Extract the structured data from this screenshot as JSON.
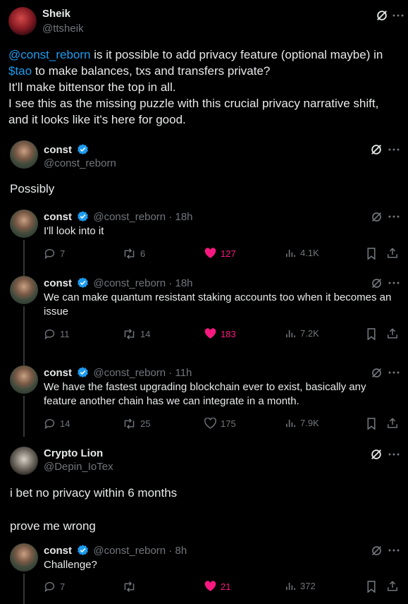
{
  "main_post": {
    "author_name": "Sheik",
    "author_handle": "@ttsheik",
    "mention": "@const_reborn",
    "text_part1": " is it possible to add privacy feature (optional maybe) in",
    "cashtag": "$tao",
    "text_part2": " to make balances, txs and transfers private?",
    "line3": "It'll make bittensor the top in all.",
    "line4": "I see this as the missing puzzle with this crucial privacy narrative shift,",
    "line5": "and it looks like it's here for good."
  },
  "reply1": {
    "author_name": "const",
    "author_handle": "@const_reborn",
    "text": "Possibly"
  },
  "thread": [
    {
      "author_name": "const",
      "meta": "@const_reborn · 18h",
      "text_lines": [
        "I'll look into it"
      ],
      "replies": "7",
      "reposts": "6",
      "likes": "127",
      "views": "4.1K",
      "liked": true
    },
    {
      "author_name": "const",
      "meta": "@const_reborn · 18h",
      "text_lines": [
        "We can make quantum resistant staking accounts too when it becomes an",
        "issue"
      ],
      "replies": "11",
      "reposts": "14",
      "likes": "183",
      "views": "7.2K",
      "liked": true
    },
    {
      "author_name": "const",
      "meta": "@const_reborn · 11h",
      "text_lines": [
        "We have the fastest upgrading blockchain ever to exist, basically any",
        "feature another chain has we can integrate in a month."
      ],
      "replies": "14",
      "reposts": "25",
      "likes": "175",
      "views": "7.9K",
      "liked": false
    }
  ],
  "reply2": {
    "author_name": "Crypto Lion",
    "author_handle": "@Depin_IoTex",
    "line1": "i bet no privacy within 6 months",
    "line2": "prove me wrong"
  },
  "last_reply": {
    "author_name": "const",
    "meta": "@const_reborn · 8h",
    "text": "Challenge?",
    "replies": "7",
    "reposts": "",
    "likes": "21",
    "views": "372",
    "liked": true
  },
  "colors": {
    "background": "#000000",
    "link": "#1d9bf0",
    "like": "#f91880",
    "muted": "#71767b",
    "verified": "#1d9bf0"
  },
  "icons": [
    "grok-icon",
    "more-icon",
    "verified-badge-icon",
    "reply-icon",
    "repost-icon",
    "heart-icon",
    "views-icon",
    "bookmark-icon",
    "share-icon"
  ]
}
